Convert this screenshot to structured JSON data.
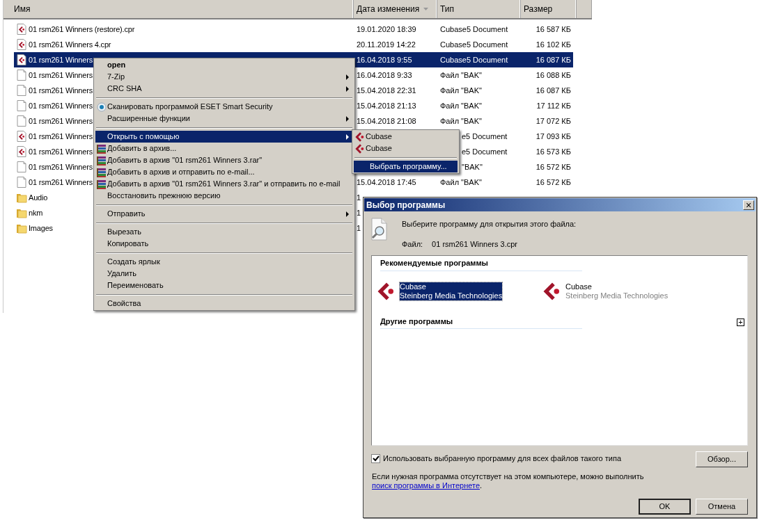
{
  "explorer": {
    "columns": [
      {
        "label": "Имя",
        "sorted": false
      },
      {
        "label": "Дата изменения",
        "sorted": true
      },
      {
        "label": "Тип",
        "sorted": false
      },
      {
        "label": "Размер",
        "sorted": false
      }
    ],
    "rows": [
      {
        "kind": "cpr",
        "name": "01 rsm261 Winners (restore).cpr",
        "date": "19.01.2020 18:39",
        "type": "Cubase5 Document",
        "size": "16 587 КБ",
        "selected": false
      },
      {
        "kind": "cpr",
        "name": "01 rsm261 Winners 4.cpr",
        "date": "20.11.2019 14:22",
        "type": "Cubase5 Document",
        "size": "16 102 КБ",
        "selected": false
      },
      {
        "kind": "cpr",
        "name": "01 rsm261 Winners",
        "date": "16.04.2018 9:55",
        "type": "Cubase5 Document",
        "size": "16 087 КБ",
        "selected": true
      },
      {
        "kind": "file",
        "name": "01 rsm261 Winners",
        "date": "16.04.2018 9:33",
        "type": "Файл \"BAK\"",
        "size": "16 088 КБ",
        "selected": false
      },
      {
        "kind": "file",
        "name": "01 rsm261 Winners",
        "date": "15.04.2018 22:31",
        "type": "Файл \"BAK\"",
        "size": "16 087 КБ",
        "selected": false
      },
      {
        "kind": "file",
        "name": "01 rsm261 Winners",
        "date": "15.04.2018 21:13",
        "type": "Файл \"BAK\"",
        "size": "17 112 КБ",
        "selected": false
      },
      {
        "kind": "file",
        "name": "01 rsm261 Winners",
        "date": "15.04.2018 21:08",
        "type": "Файл \"BAK\"",
        "size": "17 072 КБ",
        "selected": false
      },
      {
        "kind": "cpr",
        "name": "01 rsm261 Winners",
        "type": "e5 Document",
        "size": "17 093 КБ",
        "selected": false
      },
      {
        "kind": "cpr",
        "name": "01 rsm261 Winners",
        "type": "e5 Document",
        "size": "16 573 КБ",
        "selected": false
      },
      {
        "kind": "file",
        "name": "01 rsm261 Winners",
        "type": "\"BAK\"",
        "size": "16 572 КБ",
        "selected": false
      },
      {
        "kind": "file",
        "name": "01 rsm261 Winners",
        "date": "15.04.2018 17:45",
        "type": "Файл \"BAK\"",
        "size": "16 572 КБ",
        "selected": false
      },
      {
        "kind": "folder",
        "name": "Audio",
        "date": "1",
        "selected": false
      },
      {
        "kind": "folder",
        "name": "nkm",
        "date": "1",
        "selected": false
      },
      {
        "kind": "folder",
        "name": "Images",
        "date": "1",
        "selected": false
      }
    ]
  },
  "context_menu": {
    "items": [
      {
        "kind": "plain",
        "label": "open",
        "bold": true,
        "submenu": false,
        "selected": false
      },
      {
        "kind": "plain",
        "label": "7-Zip",
        "bold": false,
        "submenu": true,
        "selected": false
      },
      {
        "kind": "plain",
        "label": "CRC SHA",
        "bold": false,
        "submenu": true,
        "selected": false
      },
      {
        "kind": "separator"
      },
      {
        "kind": "eset",
        "label": "Сканировать программой ESET Smart Security",
        "bold": false,
        "submenu": false,
        "selected": false
      },
      {
        "kind": "plain",
        "label": "Расширенные функции",
        "bold": false,
        "submenu": true,
        "selected": false
      },
      {
        "kind": "separator"
      },
      {
        "kind": "plain",
        "label": "Открыть с помощью",
        "bold": false,
        "submenu": true,
        "selected": true
      },
      {
        "kind": "archive",
        "label": "Добавить в архив...",
        "bold": false,
        "submenu": false,
        "selected": false
      },
      {
        "kind": "archive",
        "label": "Добавить в архив \"01 rsm261 Winners 3.rar\"",
        "bold": false,
        "submenu": false,
        "selected": false
      },
      {
        "kind": "archive",
        "label": "Добавить в архив и отправить по e-mail...",
        "bold": false,
        "submenu": false,
        "selected": false
      },
      {
        "kind": "archive",
        "label": "Добавить в архив \"01 rsm261 Winners 3.rar\" и отправить по e-mail",
        "bold": false,
        "submenu": false,
        "selected": false
      },
      {
        "kind": "plain",
        "label": "Восстановить прежнюю версию",
        "bold": false,
        "submenu": false,
        "selected": false
      },
      {
        "kind": "separator"
      },
      {
        "kind": "plain",
        "label": "Отправить",
        "bold": false,
        "submenu": true,
        "selected": false
      },
      {
        "kind": "separator"
      },
      {
        "kind": "plain",
        "label": "Вырезать",
        "bold": false,
        "submenu": false,
        "selected": false
      },
      {
        "kind": "plain",
        "label": "Копировать",
        "bold": false,
        "submenu": false,
        "selected": false
      },
      {
        "kind": "separator"
      },
      {
        "kind": "plain",
        "label": "Создать ярлык",
        "bold": false,
        "submenu": false,
        "selected": false
      },
      {
        "kind": "plain",
        "label": "Удалить",
        "bold": false,
        "submenu": false,
        "selected": false
      },
      {
        "kind": "plain",
        "label": "Переименовать",
        "bold": false,
        "submenu": false,
        "selected": false
      },
      {
        "kind": "separator"
      },
      {
        "kind": "plain",
        "label": "Свойства",
        "bold": false,
        "submenu": false,
        "selected": false
      }
    ]
  },
  "open_with_submenu": {
    "items": [
      {
        "kind": "app",
        "label": "Cubase",
        "selected": false
      },
      {
        "kind": "app",
        "label": "Cubase",
        "selected": false
      },
      {
        "kind": "separator"
      },
      {
        "kind": "plain",
        "label": "Выбрать программу...",
        "selected": true
      }
    ]
  },
  "dialog": {
    "title": "Выбор программы",
    "close": "×",
    "prompt": "Выберите программу для открытия этого файла:",
    "file_label": "Файл:",
    "file_name": "01 rsm261 Winners 3.cpr",
    "recommended": {
      "heading": "Рекомендуемые программы",
      "programs": [
        {
          "name": "Cubase",
          "vendor": "Steinberg Media Technologies",
          "selected": true
        },
        {
          "name": "Cubase",
          "vendor": "Steinberg Media Technologies",
          "selected": false
        }
      ]
    },
    "other": {
      "heading": "Другие программы",
      "expander": "+",
      "expanded": false
    },
    "always_use": {
      "label": "Использовать выбранную программу для всех файлов такого типа",
      "checked": true
    },
    "browse_button": "Обзор...",
    "info_text": "Если нужная программа отсутствует на этом компьютере, можно выполнить",
    "info_link": "поиск программы в Интернете",
    "info_end": ".",
    "buttons": [
      {
        "label": "OK",
        "default": true
      },
      {
        "label": "Отмена",
        "default": false
      }
    ]
  }
}
